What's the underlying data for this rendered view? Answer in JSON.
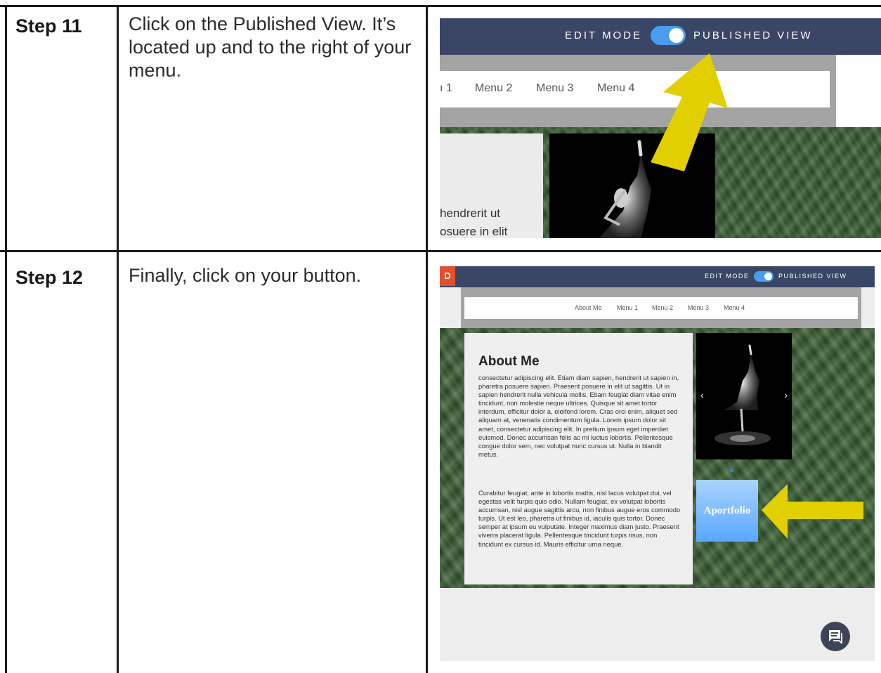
{
  "rows": [
    {
      "step": "Step 11",
      "instruction": "Click on the Published View. It’s located up and to the right of your menu."
    },
    {
      "step": "Step 12",
      "instruction": "Finally, click on your button."
    }
  ],
  "shot1": {
    "edit_mode": "EDIT MODE",
    "published_view": "PUBLISHED VIEW",
    "menu": [
      "ı 1",
      "Menu 2",
      "Menu 3",
      "Menu 4"
    ],
    "text_line1": "hendrerit ut",
    "text_line2": "osuere in elit"
  },
  "shot2": {
    "logo": "D",
    "edit_mode": "EDIT MODE",
    "published_view": "PUBLISHED VIEW",
    "menu": [
      "About Me",
      "Menu 1",
      "Menu 2",
      "Menu 3",
      "Menu 4"
    ],
    "about_title": "About Me",
    "paragraph1": "consectetur adipiscing elit. Etiam diam sapien, hendrerit ut sapien in, pharetra posuere sapien. Praesent posuere in elit ut sagittis. Ut in sapien hendrerit nulla vehicula mollis. Etiam feugiat diam vitae enim tincidunt, non molestie neque ultrices. Quisque sit amet tortor interdum, efficitur dolor a, eleifend lorem. Cras orci enim, aliquet sed aliquam at, venenatis condimentum ligula. Lorem ipsum dolor sit amet, consectetur adipiscing elit. In pretium ipsum eget imperdiet euismod. Donec accumsan felis ac mi luctus lobortis. Pellentesque congue dolor sem, nec volutpat nunc cursus ut. Nulla in blandit metus.",
    "paragraph2": "Curabitur feugiat, ante in lobortis mattis, nisl lacus volutpat dui, vel egestas velit turpis quis odio. Nullam feugiat, ex volutpat lobortis accumsan, nisl augue sagittis arcu, non finibus augue eros commodo turpis. Ut est leo, pharetra ut finibus id, iaculis quis tortor. Donec semper at ipsum eu vulputate. Integer maximus diam justo. Praesent viverra placerat ligula. Pellentesque tincidunt turpis risus, non tincidunt ex cursus id. Mauris efficitur urna neque.",
    "prev": "‹",
    "next": "›",
    "button_label": "Aportfolio"
  },
  "colors": {
    "topbar": "#3a4666",
    "toggle": "#4a9cf0",
    "arrow": "#e1cf00",
    "button_gradient_top": "#a9d3ff",
    "button_gradient_bottom": "#5aa7ff"
  }
}
